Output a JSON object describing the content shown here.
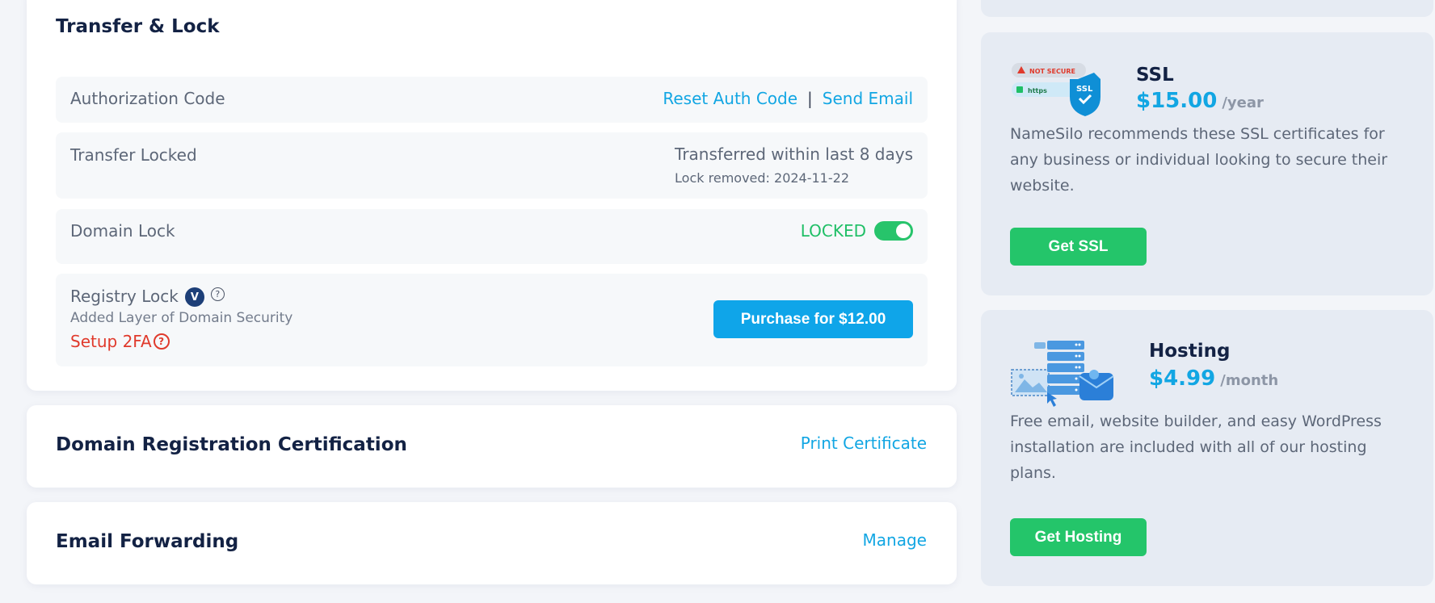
{
  "transfer_lock": {
    "title": "Transfer & Lock",
    "authorization": {
      "label": "Authorization Code",
      "reset_link": "Reset Auth Code",
      "separator": "|",
      "send_link": "Send Email"
    },
    "transfer_locked": {
      "label": "Transfer Locked",
      "status": "Transferred within last 8 days",
      "lock_removed": "Lock removed: 2024-11-22"
    },
    "domain_lock": {
      "label": "Domain Lock",
      "status": "LOCKED",
      "toggle_on": true
    },
    "registry_lock": {
      "label": "Registry Lock",
      "badge_letter": "V",
      "help_glyph": "?",
      "subtitle": "Added Layer of Domain Security",
      "setup_2fa": "Setup 2FA",
      "purchase_button": "Purchase for $12.00"
    }
  },
  "certification": {
    "title": "Domain Registration Certification",
    "link": "Print Certificate"
  },
  "email_forwarding": {
    "title": "Email Forwarding",
    "link": "Manage"
  },
  "promos": {
    "ssl": {
      "name": "SSL",
      "price": "$15.00",
      "period": "/year",
      "description": "NameSilo recommends these SSL certificates for any business or individual looking to secure their website.",
      "button": "Get SSL",
      "art": {
        "warning_text": "NOT SECURE",
        "https_text": "https",
        "shield_text": "SSL"
      }
    },
    "hosting": {
      "name": "Hosting",
      "price": "$4.99",
      "period": "/month",
      "description": "Free email, website builder, and easy WordPress installation are included with all of our hosting plans.",
      "button": "Get Hosting"
    }
  },
  "colors": {
    "accent_blue": "#12a6e3",
    "locked_green": "#1fbf66",
    "button_green": "#24c56a",
    "error_red": "#e03a2c"
  }
}
